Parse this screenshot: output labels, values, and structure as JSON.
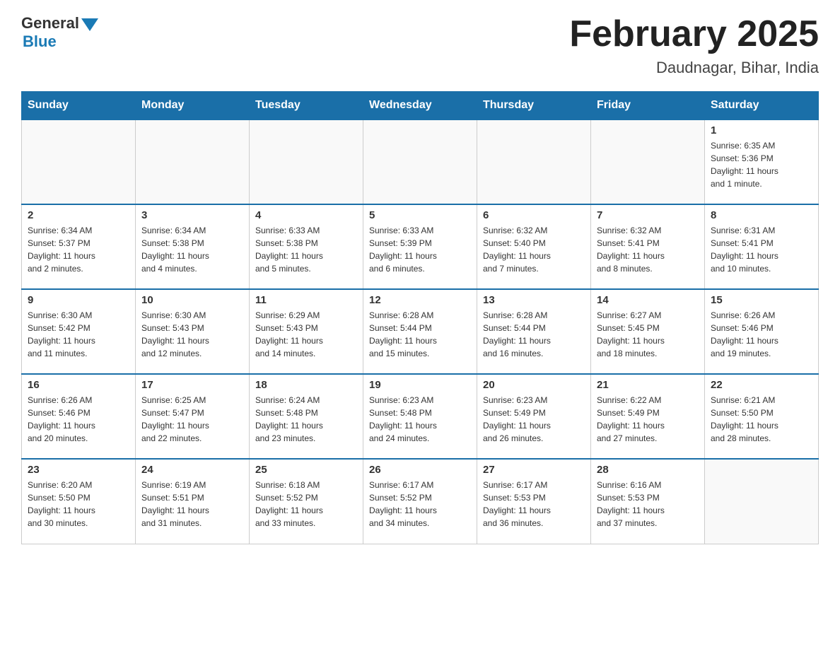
{
  "logo": {
    "general": "General",
    "blue": "Blue"
  },
  "title": "February 2025",
  "subtitle": "Daudnagar, Bihar, India",
  "days_header": [
    "Sunday",
    "Monday",
    "Tuesday",
    "Wednesday",
    "Thursday",
    "Friday",
    "Saturday"
  ],
  "weeks": [
    [
      {
        "day": "",
        "info": ""
      },
      {
        "day": "",
        "info": ""
      },
      {
        "day": "",
        "info": ""
      },
      {
        "day": "",
        "info": ""
      },
      {
        "day": "",
        "info": ""
      },
      {
        "day": "",
        "info": ""
      },
      {
        "day": "1",
        "info": "Sunrise: 6:35 AM\nSunset: 5:36 PM\nDaylight: 11 hours\nand 1 minute."
      }
    ],
    [
      {
        "day": "2",
        "info": "Sunrise: 6:34 AM\nSunset: 5:37 PM\nDaylight: 11 hours\nand 2 minutes."
      },
      {
        "day": "3",
        "info": "Sunrise: 6:34 AM\nSunset: 5:38 PM\nDaylight: 11 hours\nand 4 minutes."
      },
      {
        "day": "4",
        "info": "Sunrise: 6:33 AM\nSunset: 5:38 PM\nDaylight: 11 hours\nand 5 minutes."
      },
      {
        "day": "5",
        "info": "Sunrise: 6:33 AM\nSunset: 5:39 PM\nDaylight: 11 hours\nand 6 minutes."
      },
      {
        "day": "6",
        "info": "Sunrise: 6:32 AM\nSunset: 5:40 PM\nDaylight: 11 hours\nand 7 minutes."
      },
      {
        "day": "7",
        "info": "Sunrise: 6:32 AM\nSunset: 5:41 PM\nDaylight: 11 hours\nand 8 minutes."
      },
      {
        "day": "8",
        "info": "Sunrise: 6:31 AM\nSunset: 5:41 PM\nDaylight: 11 hours\nand 10 minutes."
      }
    ],
    [
      {
        "day": "9",
        "info": "Sunrise: 6:30 AM\nSunset: 5:42 PM\nDaylight: 11 hours\nand 11 minutes."
      },
      {
        "day": "10",
        "info": "Sunrise: 6:30 AM\nSunset: 5:43 PM\nDaylight: 11 hours\nand 12 minutes."
      },
      {
        "day": "11",
        "info": "Sunrise: 6:29 AM\nSunset: 5:43 PM\nDaylight: 11 hours\nand 14 minutes."
      },
      {
        "day": "12",
        "info": "Sunrise: 6:28 AM\nSunset: 5:44 PM\nDaylight: 11 hours\nand 15 minutes."
      },
      {
        "day": "13",
        "info": "Sunrise: 6:28 AM\nSunset: 5:44 PM\nDaylight: 11 hours\nand 16 minutes."
      },
      {
        "day": "14",
        "info": "Sunrise: 6:27 AM\nSunset: 5:45 PM\nDaylight: 11 hours\nand 18 minutes."
      },
      {
        "day": "15",
        "info": "Sunrise: 6:26 AM\nSunset: 5:46 PM\nDaylight: 11 hours\nand 19 minutes."
      }
    ],
    [
      {
        "day": "16",
        "info": "Sunrise: 6:26 AM\nSunset: 5:46 PM\nDaylight: 11 hours\nand 20 minutes."
      },
      {
        "day": "17",
        "info": "Sunrise: 6:25 AM\nSunset: 5:47 PM\nDaylight: 11 hours\nand 22 minutes."
      },
      {
        "day": "18",
        "info": "Sunrise: 6:24 AM\nSunset: 5:48 PM\nDaylight: 11 hours\nand 23 minutes."
      },
      {
        "day": "19",
        "info": "Sunrise: 6:23 AM\nSunset: 5:48 PM\nDaylight: 11 hours\nand 24 minutes."
      },
      {
        "day": "20",
        "info": "Sunrise: 6:23 AM\nSunset: 5:49 PM\nDaylight: 11 hours\nand 26 minutes."
      },
      {
        "day": "21",
        "info": "Sunrise: 6:22 AM\nSunset: 5:49 PM\nDaylight: 11 hours\nand 27 minutes."
      },
      {
        "day": "22",
        "info": "Sunrise: 6:21 AM\nSunset: 5:50 PM\nDaylight: 11 hours\nand 28 minutes."
      }
    ],
    [
      {
        "day": "23",
        "info": "Sunrise: 6:20 AM\nSunset: 5:50 PM\nDaylight: 11 hours\nand 30 minutes."
      },
      {
        "day": "24",
        "info": "Sunrise: 6:19 AM\nSunset: 5:51 PM\nDaylight: 11 hours\nand 31 minutes."
      },
      {
        "day": "25",
        "info": "Sunrise: 6:18 AM\nSunset: 5:52 PM\nDaylight: 11 hours\nand 33 minutes."
      },
      {
        "day": "26",
        "info": "Sunrise: 6:17 AM\nSunset: 5:52 PM\nDaylight: 11 hours\nand 34 minutes."
      },
      {
        "day": "27",
        "info": "Sunrise: 6:17 AM\nSunset: 5:53 PM\nDaylight: 11 hours\nand 36 minutes."
      },
      {
        "day": "28",
        "info": "Sunrise: 6:16 AM\nSunset: 5:53 PM\nDaylight: 11 hours\nand 37 minutes."
      },
      {
        "day": "",
        "info": ""
      }
    ]
  ]
}
